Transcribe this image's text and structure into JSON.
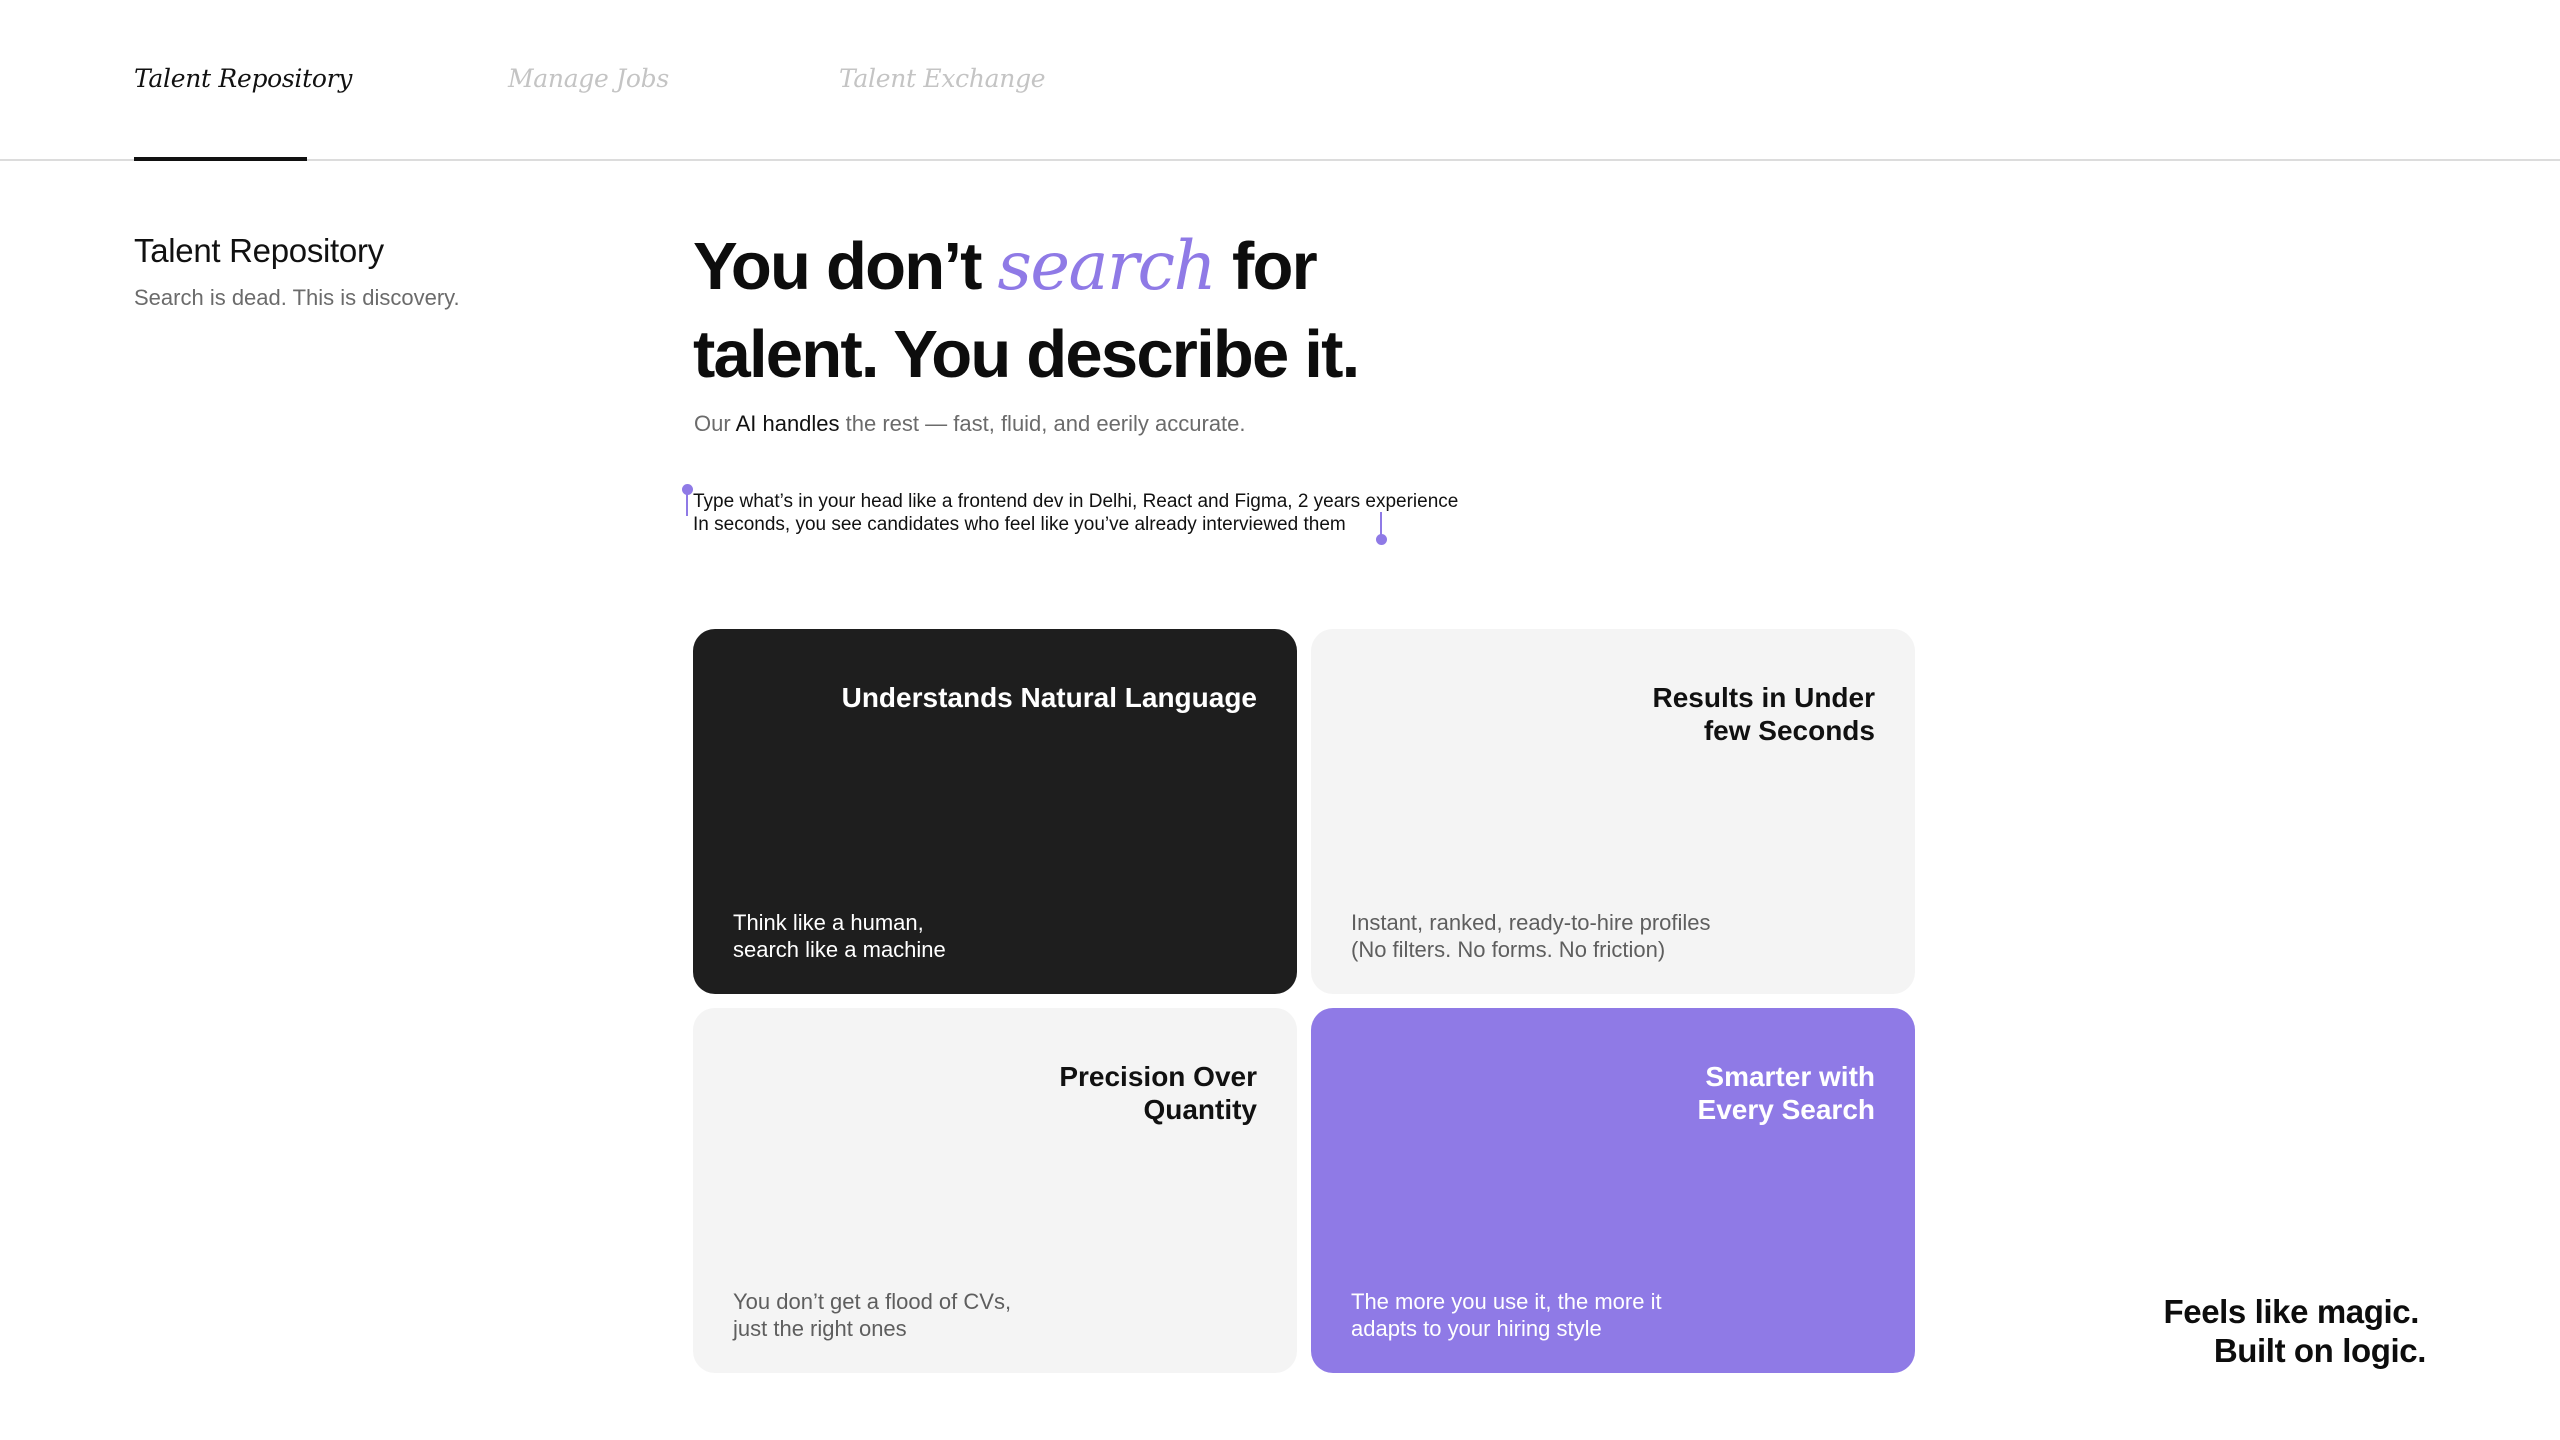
{
  "nav": {
    "tabs": [
      {
        "label": "Talent Repository",
        "active": true
      },
      {
        "label": "Manage Jobs",
        "active": false
      },
      {
        "label": "Talent Exchange",
        "active": false
      }
    ]
  },
  "sidebar": {
    "title": "Talent Repository",
    "subtitle": "Search is dead. This is discovery."
  },
  "hero": {
    "part1": "You don’t ",
    "emphasis": "search",
    "part2": " for",
    "line2": "talent. You describe it."
  },
  "tagline": {
    "prefix": "Our ",
    "strong": "AI handles",
    "suffix": " the rest — fast, fluid, and eerily accurate."
  },
  "selection": {
    "line1": "Type what’s in your head like a frontend dev in Delhi, React and Figma, 2 years experience",
    "line2": "In seconds, you see candidates who feel like you’ve already interviewed them"
  },
  "cards": [
    {
      "title": "Understands Natural Language",
      "desc_line1": "Think like a human,",
      "desc_line2": "search like a machine",
      "theme": "dark"
    },
    {
      "title": "Results in Under few Seconds",
      "desc_line1": "Instant, ranked, ready-to-hire profiles",
      "desc_line2": "(No filters. No forms. No friction)",
      "theme": "light"
    },
    {
      "title": "Precision Over Quantity",
      "desc_line1": "You don’t get a flood of CVs,",
      "desc_line2": "just the right ones",
      "theme": "light"
    },
    {
      "title": "Smarter with Every Search",
      "desc_line1": "The more you use it, the more it",
      "desc_line2": "adapts to your hiring style",
      "theme": "purple"
    }
  ],
  "footer": {
    "line1": "Feels like magic.",
    "line2": "Built on logic."
  },
  "colors": {
    "accent": "#8f7ae6",
    "dark_card": "#1e1e1e",
    "light_card": "#f4f4f4"
  }
}
